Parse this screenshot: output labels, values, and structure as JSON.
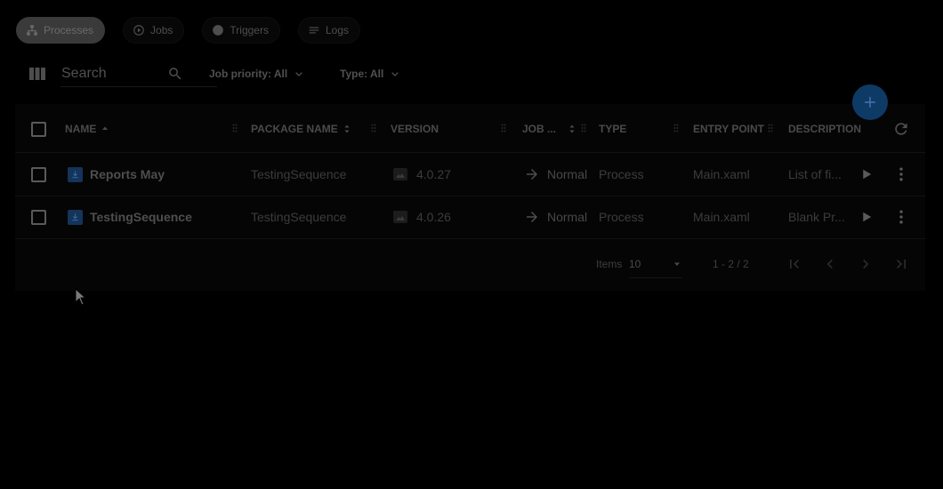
{
  "nav": {
    "tabs": [
      {
        "label": "Processes",
        "icon": "sitemap-icon",
        "active": true
      },
      {
        "label": "Jobs",
        "icon": "play-circle-icon",
        "active": false
      },
      {
        "label": "Triggers",
        "icon": "bolt-icon",
        "active": false
      },
      {
        "label": "Logs",
        "icon": "list-icon",
        "active": false
      }
    ]
  },
  "toolbar": {
    "search_placeholder": "Search",
    "filters": {
      "job_priority": "Job priority: All",
      "type": "Type: All"
    }
  },
  "table": {
    "columns": {
      "name": "NAME",
      "package_name": "PACKAGE NAME",
      "version": "VERSION",
      "job_priority": "JOB ...",
      "type": "TYPE",
      "entry_point": "ENTRY POINT",
      "description": "DESCRIPTION"
    },
    "rows": [
      {
        "name": "Reports May",
        "package_name": "TestingSequence",
        "version": "4.0.27",
        "job_priority": "Normal",
        "type": "Process",
        "entry_point": "Main.xaml",
        "description": "List of fi..."
      },
      {
        "name": "TestingSequence",
        "package_name": "TestingSequence",
        "version": "4.0.26",
        "job_priority": "Normal",
        "type": "Process",
        "entry_point": "Main.xaml",
        "description": "Blank Pr..."
      }
    ]
  },
  "pagination": {
    "items_label": "Items",
    "items_per_page": "10",
    "range": "1 - 2 / 2"
  },
  "colors": {
    "accent": "#0e3a66",
    "background": "#000000"
  }
}
